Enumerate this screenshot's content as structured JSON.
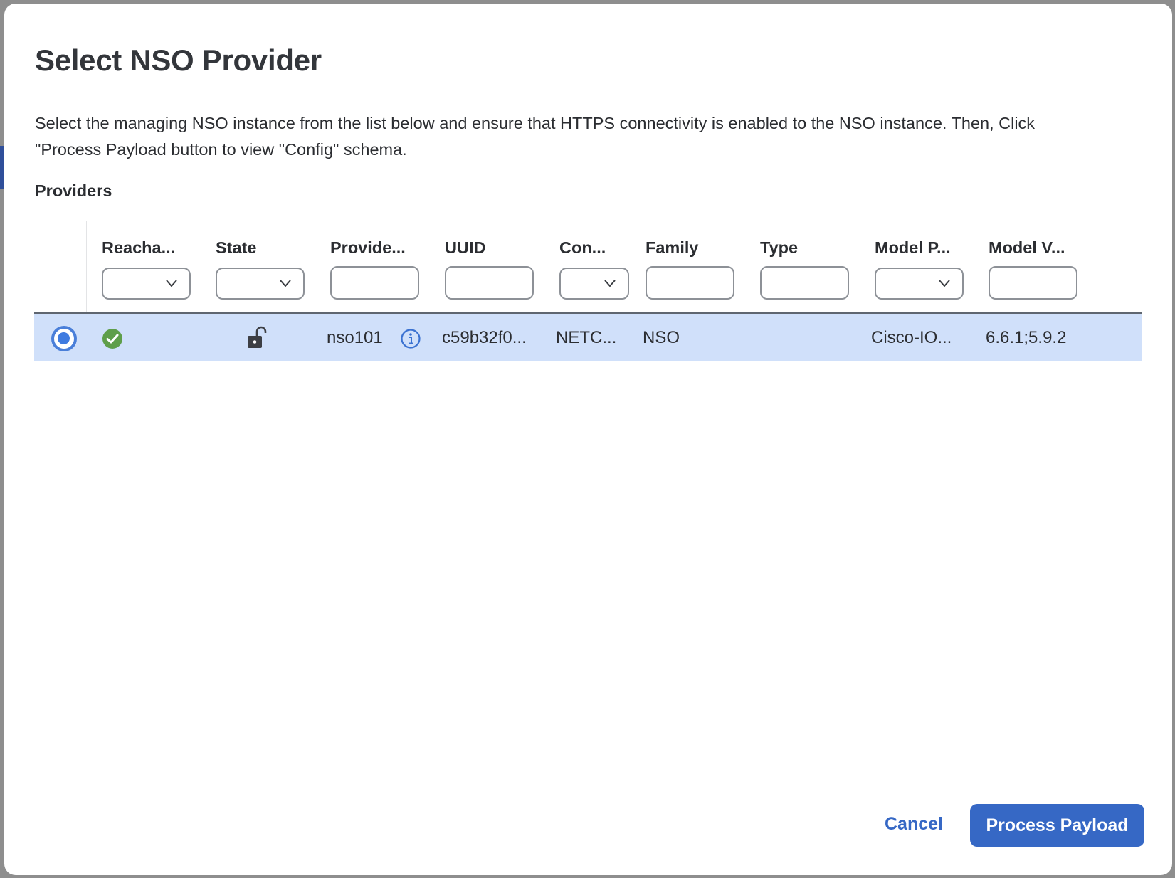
{
  "dialog": {
    "title": "Select NSO Provider",
    "description": "Select the managing NSO instance from the list below and ensure that HTTPS connectivity is enabled to the NSO instance. Then, Click \"Process Payload button to view \"Config\" schema.",
    "section_label": "Providers"
  },
  "table": {
    "columns": [
      {
        "label": "Reacha...",
        "filter": "select"
      },
      {
        "label": "State",
        "filter": "select"
      },
      {
        "label": "Provide...",
        "filter": "text"
      },
      {
        "label": "UUID",
        "filter": "text"
      },
      {
        "label": "Con...",
        "filter": "select"
      },
      {
        "label": "Family",
        "filter": "text"
      },
      {
        "label": "Type",
        "filter": "text"
      },
      {
        "label": "Model P...",
        "filter": "select"
      },
      {
        "label": "Model V...",
        "filter": "text"
      }
    ],
    "rows": [
      {
        "selected": true,
        "reachability_icon": "check-circle-icon",
        "state_icon": "unlock-icon",
        "provider": "nso101",
        "provider_info_icon": "info-icon",
        "uuid": "c59b32f0...",
        "connection": "NETC...",
        "family": "NSO",
        "type": "",
        "model_prefix": "Cisco-IO...",
        "model_version": "6.6.1;5.9.2"
      }
    ]
  },
  "footer": {
    "cancel_label": "Cancel",
    "primary_label": "Process Payload"
  },
  "colors": {
    "accent": "#3668c5",
    "selected_row": "#d0e0fa",
    "success": "#5e9e4a"
  }
}
